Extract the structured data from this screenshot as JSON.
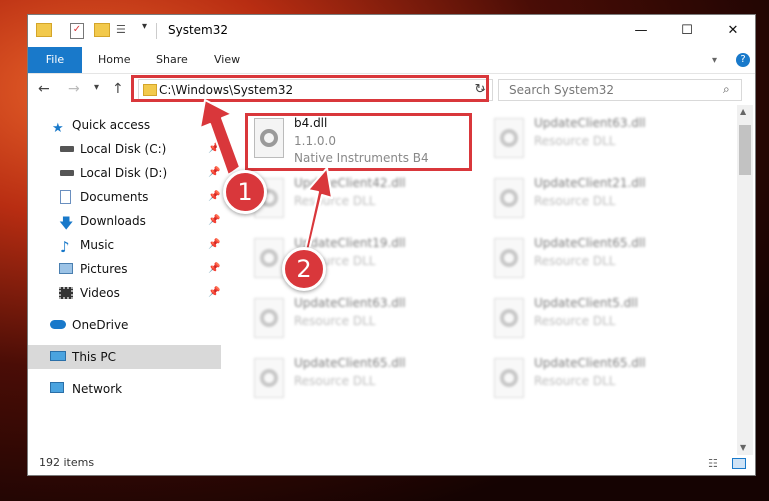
{
  "window": {
    "title": "System32",
    "minimize_icon": "minimize-icon",
    "maximize_icon": "maximize-icon",
    "close_icon": "close-icon"
  },
  "ribbon": {
    "tabs": [
      "File",
      "Home",
      "Share",
      "View"
    ],
    "help": "?"
  },
  "address": {
    "path": "C:\\Windows\\System32"
  },
  "search": {
    "placeholder": "Search System32"
  },
  "sidebar": {
    "items": [
      {
        "label": "Quick access",
        "icon": "star-icon",
        "pinned": false
      },
      {
        "label": "Local Disk (C:)",
        "icon": "drive-icon",
        "pinned": true
      },
      {
        "label": "Local Disk (D:)",
        "icon": "drive-icon",
        "pinned": true
      },
      {
        "label": "Documents",
        "icon": "documents-icon",
        "pinned": true
      },
      {
        "label": "Downloads",
        "icon": "download-icon",
        "pinned": true
      },
      {
        "label": "Music",
        "icon": "music-icon",
        "pinned": true
      },
      {
        "label": "Pictures",
        "icon": "pictures-icon",
        "pinned": true
      },
      {
        "label": "Videos",
        "icon": "videos-icon",
        "pinned": true
      },
      {
        "label": "OneDrive",
        "icon": "cloud-icon",
        "pinned": false
      },
      {
        "label": "This PC",
        "icon": "computer-icon",
        "pinned": false
      },
      {
        "label": "Network",
        "icon": "network-icon",
        "pinned": false
      }
    ]
  },
  "files": [
    {
      "name": "b4.dll",
      "line2": "1.1.0.0",
      "line3": "Native Instruments B4"
    },
    {
      "name": "UpdateClient63.dll",
      "line2": "Resource DLL"
    },
    {
      "name": "UpdateClient42.dll",
      "line2": "Resource DLL"
    },
    {
      "name": "UpdateClient21.dll",
      "line2": "Resource DLL"
    },
    {
      "name": "UpdateClient19.dll",
      "line2": "Resource DLL"
    },
    {
      "name": "UpdateClient65.dll",
      "line2": "Resource DLL"
    },
    {
      "name": "UpdateClient63.dll",
      "line2": "Resource DLL"
    },
    {
      "name": "UpdateClient5.dll",
      "line2": "Resource DLL"
    },
    {
      "name": "UpdateClient65.dll",
      "line2": "Resource DLL"
    },
    {
      "name": "UpdateClient65.dll",
      "line2": "Resource DLL"
    }
  ],
  "status": {
    "count": "192 items"
  },
  "annotations": {
    "step1": "1",
    "step2": "2",
    "color": "#d9373b"
  }
}
